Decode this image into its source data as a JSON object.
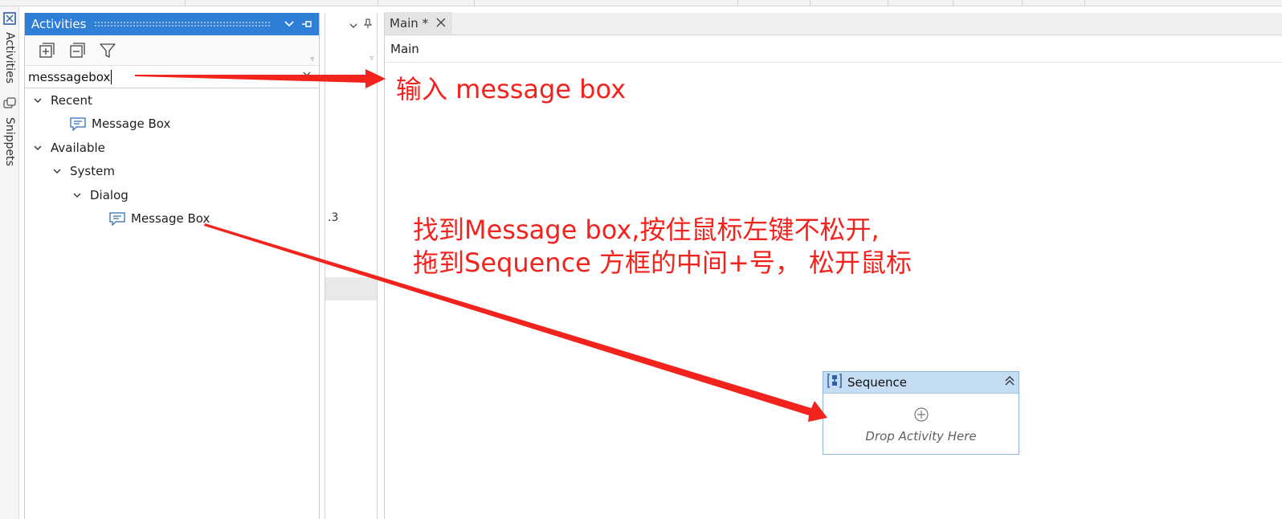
{
  "vertical_tabs": [
    {
      "label": "Activities",
      "icon": "activities-icon"
    },
    {
      "label": "Snippets",
      "icon": "snippets-icon"
    }
  ],
  "activities_panel": {
    "title": "Activities",
    "search": {
      "value": "messsagebox"
    },
    "tree": [
      {
        "label": "Recent",
        "expanded": true,
        "level": 0
      },
      {
        "label": "Message Box",
        "icon": "message-box-icon",
        "level": 2
      },
      {
        "label": "Available",
        "expanded": true,
        "level": 0
      },
      {
        "label": "System",
        "expanded": true,
        "level": 1
      },
      {
        "label": "Dialog",
        "expanded": true,
        "level": 2
      },
      {
        "label": "Message Box",
        "icon": "message-box-icon",
        "level": 4
      }
    ]
  },
  "side_panel": {
    "fragment_text": ".3"
  },
  "designer": {
    "tab": {
      "label": "Main *"
    },
    "breadcrumb": "Main",
    "sequence": {
      "title": "Sequence",
      "drop_hint": "Drop Activity Here"
    }
  },
  "annotations": {
    "search_hint": "输入 message box",
    "drag_hint_line1": "找到Message box,按住鼠标左键不松开,",
    "drag_hint_line2": "拖到Sequence 方框的中间+号， 松开鼠标"
  },
  "colors": {
    "panel_header": "#2f7fd6",
    "annotation_red": "#f2231d",
    "sequence_header": "#c5ddf2",
    "sequence_border": "#8fb5dc"
  }
}
